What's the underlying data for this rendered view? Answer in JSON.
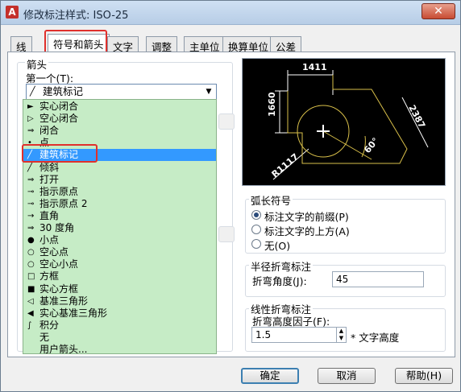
{
  "window": {
    "title": "修改标注样式: ISO-25",
    "close_label": "✕"
  },
  "tabs": [
    "线",
    "符号和箭头",
    "文字",
    "调整",
    "主单位",
    "换算单位",
    "公差"
  ],
  "active_tab": "符号和箭头",
  "arrows": {
    "group_label": "箭头",
    "first_label": "第一个(T):",
    "first_value": "建筑标记"
  },
  "dropdown_options": [
    {
      "icon": "►",
      "label": "实心闭合"
    },
    {
      "icon": "▷",
      "label": "空心闭合"
    },
    {
      "icon": "⇒",
      "label": "闭合"
    },
    {
      "icon": "•",
      "label": "点"
    },
    {
      "icon": "╱",
      "label": "建筑标记",
      "selected": true
    },
    {
      "icon": "╱",
      "label": "倾斜"
    },
    {
      "icon": "⇒",
      "label": "打开"
    },
    {
      "icon": "⊸",
      "label": "指示原点"
    },
    {
      "icon": "⊸",
      "label": "指示原点 2"
    },
    {
      "icon": "→",
      "label": "直角"
    },
    {
      "icon": "⇒",
      "label": "30 度角"
    },
    {
      "icon": "●",
      "label": "小点"
    },
    {
      "icon": "○",
      "label": "空心点"
    },
    {
      "icon": "○",
      "label": "空心小点"
    },
    {
      "icon": "□",
      "label": "方框"
    },
    {
      "icon": "■",
      "label": "实心方框"
    },
    {
      "icon": "◁",
      "label": "基准三角形"
    },
    {
      "icon": "◀",
      "label": "实心基准三角形"
    },
    {
      "icon": "∫",
      "label": "积分"
    },
    {
      "icon": "",
      "label": "无"
    },
    {
      "icon": "",
      "label": "用户箭头..."
    }
  ],
  "preview": {
    "dim_top": "1411",
    "dim_left": "1660",
    "dim_right": "2387",
    "angle": "60°",
    "radius": "R1117"
  },
  "arc_symbol": {
    "label": "弧长符号",
    "options": [
      "标注文字的前缀(P)",
      "标注文字的上方(A)",
      "无(O)"
    ],
    "selected": 0
  },
  "radius_jog": {
    "label": "半径折弯标注",
    "angle_label": "折弯角度(J):",
    "angle_value": "45"
  },
  "linear_jog": {
    "label": "线性折弯标注",
    "factor_label": "折弯高度因子(F):",
    "factor_value": "1.5",
    "suffix": "* 文字高度"
  },
  "buttons": {
    "ok": "确定",
    "cancel": "取消",
    "help": "帮助(H)"
  },
  "colors": {
    "highlight": "#e0302c",
    "list_bg": "#c6ecc6",
    "selected_bg": "#3399ff"
  }
}
